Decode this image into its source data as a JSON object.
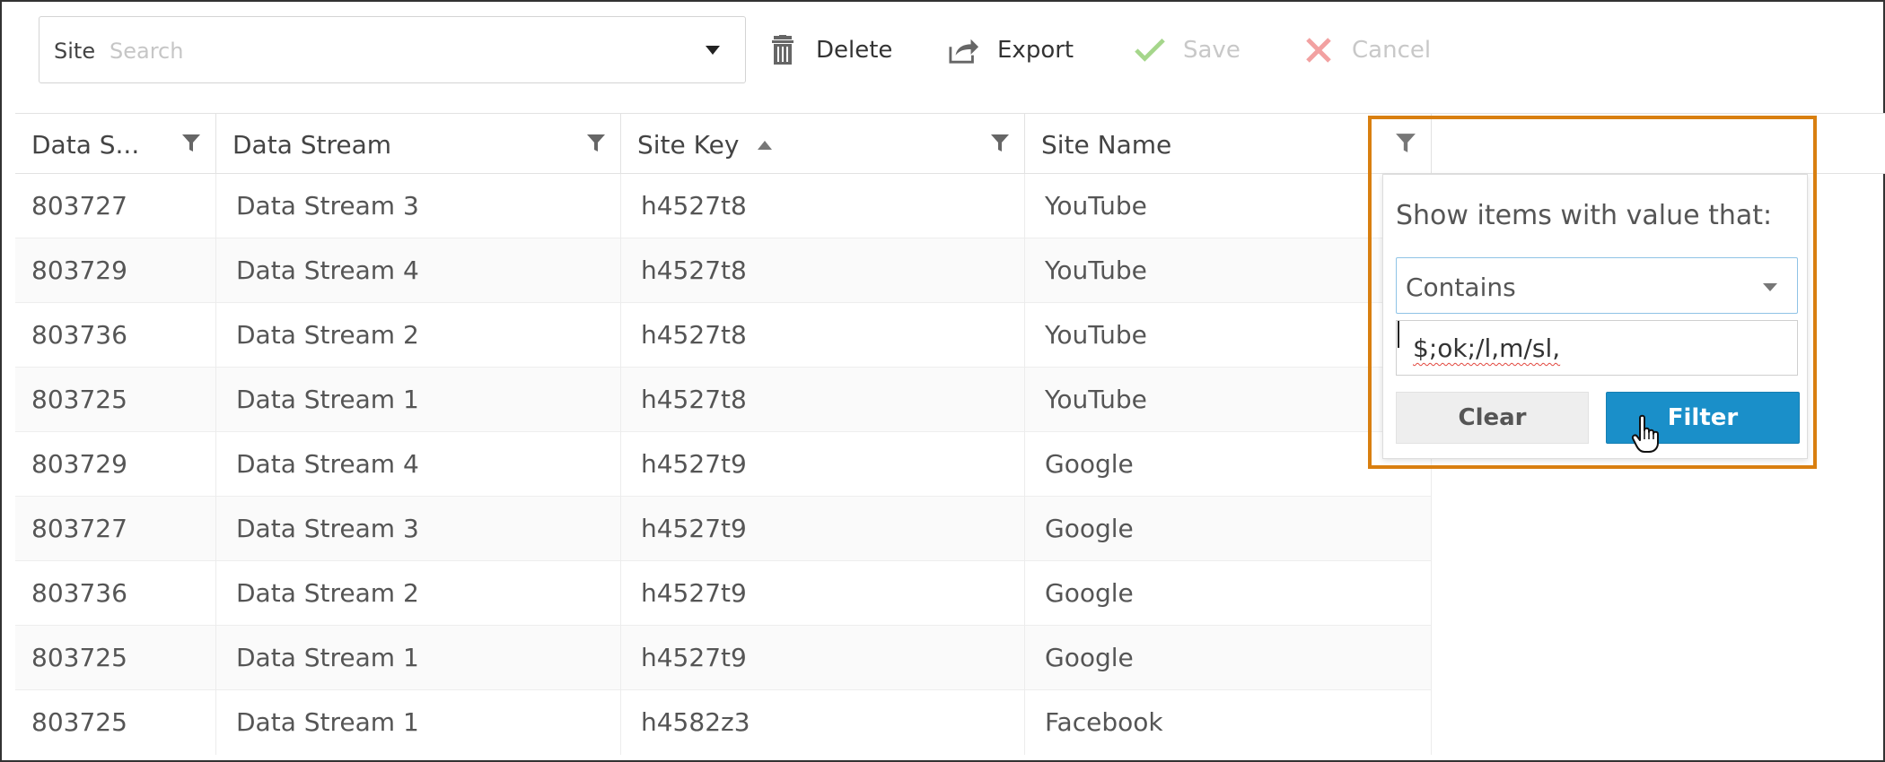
{
  "toolbar": {
    "site_label": "Site",
    "site_placeholder": "Search",
    "delete_label": "Delete",
    "export_label": "Export",
    "save_label": "Save",
    "cancel_label": "Cancel",
    "icons": {
      "delete": "trash-icon",
      "export": "share-arrow-icon",
      "save": "checkmark-icon",
      "cancel": "x-icon"
    },
    "colors": {
      "save_check": "#a5d68b",
      "cancel_x": "#f2a1a1",
      "disabled_text": "#c8c8c8"
    }
  },
  "grid": {
    "columns": [
      {
        "label": "Data S...",
        "filterable": true
      },
      {
        "label": "Data Stream",
        "filterable": true
      },
      {
        "label": "Site Key",
        "filterable": true,
        "sort": "ascending"
      },
      {
        "label": "Site Name",
        "filterable": true
      }
    ],
    "rows": [
      [
        "803727",
        "Data Stream 3",
        "h4527t8",
        "YouTube"
      ],
      [
        "803729",
        "Data Stream 4",
        "h4527t8",
        "YouTube"
      ],
      [
        "803736",
        "Data Stream 2",
        "h4527t8",
        "YouTube"
      ],
      [
        "803725",
        "Data Stream 1",
        "h4527t8",
        "YouTube"
      ],
      [
        "803729",
        "Data Stream 4",
        "h4527t9",
        "Google"
      ],
      [
        "803727",
        "Data Stream 3",
        "h4527t9",
        "Google"
      ],
      [
        "803736",
        "Data Stream 2",
        "h4527t9",
        "Google"
      ],
      [
        "803725",
        "Data Stream 1",
        "h4527t9",
        "Google"
      ],
      [
        "803725",
        "Data Stream 1",
        "h4582z3",
        "Facebook"
      ]
    ]
  },
  "filter_popup": {
    "title": "Show items with value that:",
    "operator": "Contains",
    "value": "$;ok;/l,m/sl,",
    "clear_label": "Clear",
    "filter_label": "Filter",
    "highlight_color": "#d97f10",
    "accent_color": "#1a8fc9"
  }
}
